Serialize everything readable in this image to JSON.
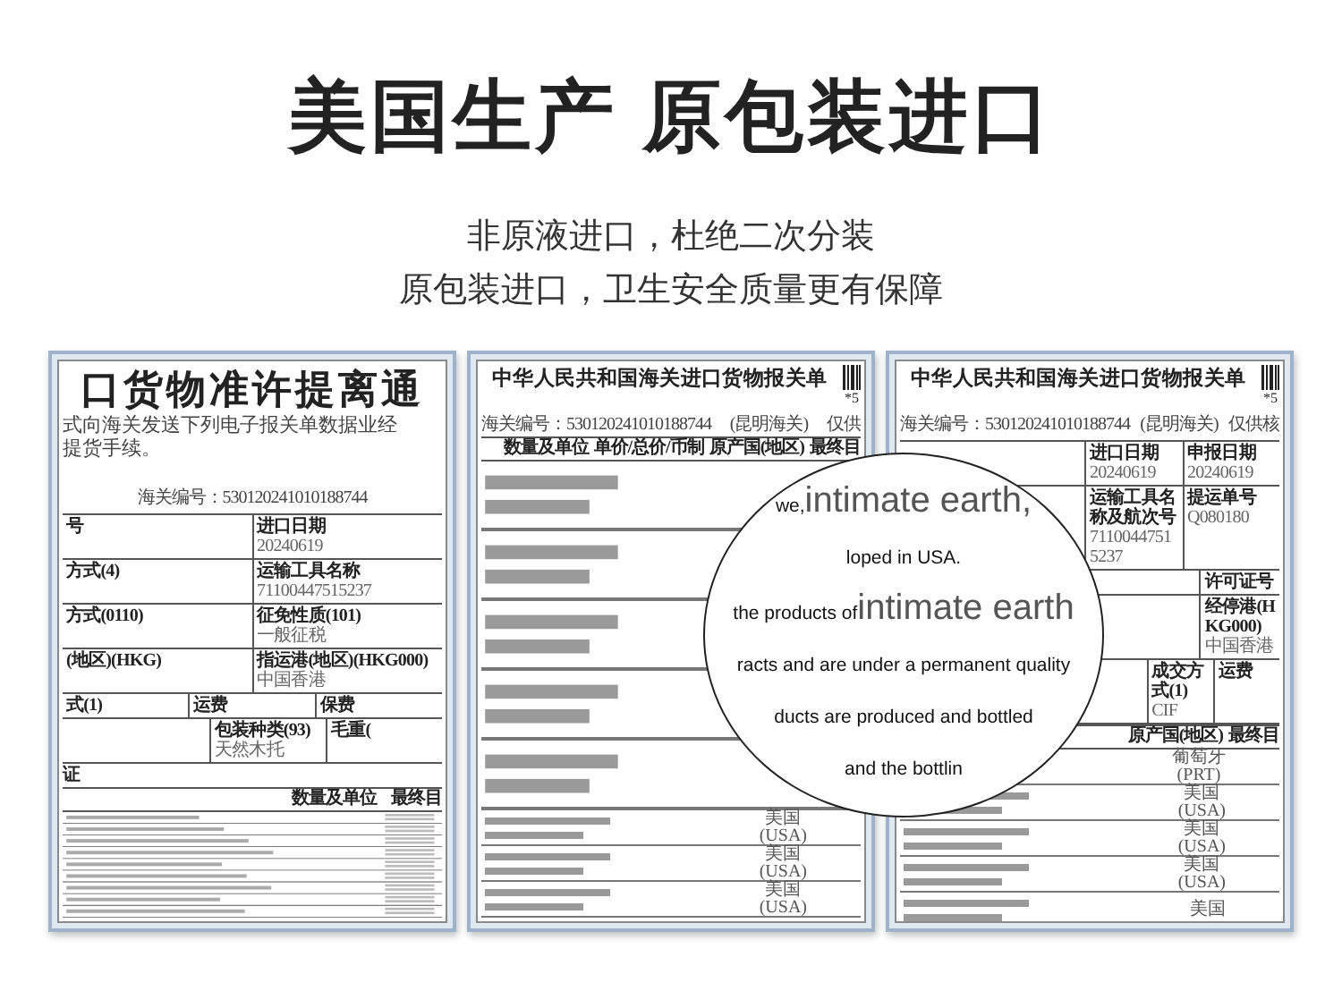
{
  "headline": "美国生产 原包装进口",
  "subtitle_lines": [
    "非原液进口，杜绝二次分装",
    "原包装进口，卫生安全质量更有保障"
  ],
  "documents": [
    {
      "kind": "release_notice",
      "title": "口货物准许提离通",
      "paragraph": [
        "式向海关发送下列电子报关单数据业经",
        "提货手续。"
      ],
      "reference": [
        "海关编号：530120241010188744"
      ],
      "field_rows": [
        [
          {
            "label": "号"
          },
          {
            "label": "进口日期",
            "value": "20240619"
          }
        ],
        [
          {
            "label": "方式(4)"
          },
          {
            "label": "运输工具名称",
            "value": "71100447515237"
          }
        ],
        [
          {
            "label": "方式(0110)"
          },
          {
            "label": "征免性质(101)",
            "value": "一般征税"
          }
        ],
        [
          {
            "label": "(地区)(HKG)"
          },
          {
            "label": "指运港(地区)(HKG000)",
            "value": "中国香港"
          }
        ],
        [
          {
            "label": "式(1)"
          },
          {
            "label": "运费"
          },
          {
            "label": "保费"
          }
        ],
        [
          {},
          {
            "label": "包装种类(93)",
            "value": "天然木托"
          },
          {
            "label": "毛重("
          }
        ]
      ],
      "section_label": "证",
      "table_header": [
        "数量及单位",
        "最终目"
      ]
    },
    {
      "kind": "declaration",
      "title": "中华人民共和国海关进口货物报关单",
      "barcode_mark": "*5",
      "reference": [
        "海关编号：530120241010188744",
        "(昆明海关)",
        "仅供"
      ],
      "table_header": [
        "数量及单位",
        "单价/总价/币制",
        "原产国(地区)",
        "最终目"
      ],
      "items": [
        {
          "origin": "美国",
          "origin_code": "(USA)"
        },
        {
          "origin": "美国",
          "origin_code": "(USA)"
        },
        {
          "origin": "美国",
          "origin_code": "(USA)"
        }
      ]
    },
    {
      "kind": "declaration",
      "title": "中华人民共和国海关进口货物报关单",
      "barcode_mark": "*5",
      "reference": [
        "海关编号：530120241010188744",
        "(昆明海关)",
        "仅供核"
      ],
      "field_rows": [
        [
          {},
          {
            "label": "进口日期",
            "value": "20240619"
          },
          {
            "label": "申报日期",
            "value": "20240619"
          }
        ],
        [
          {},
          {
            "label": "运输工具名称及航次号",
            "value": "71100447515237"
          },
          {
            "label": "提运单号",
            "value": "Q080180"
          }
        ],
        [
          {},
          {},
          {
            "label": "许可证号"
          }
        ],
        [
          {},
          {},
          {
            "label": "经停港(HKG000)",
            "value": "中国香港"
          }
        ],
        [
          {},
          {},
          {
            "label": "成交方式(1)",
            "value": "CIF"
          },
          {
            "label": "运费"
          }
        ]
      ],
      "table_header": [
        "原产国(地区)",
        "最终目"
      ],
      "items": [
        {
          "origin": "葡萄牙",
          "origin_code": "(PRT)"
        },
        {
          "origin": "美国",
          "origin_code": "(USA)"
        },
        {
          "origin": "美国",
          "origin_code": "(USA)"
        },
        {
          "origin": "美国",
          "origin_code": "(USA)"
        },
        {
          "origin": "美国"
        }
      ]
    }
  ],
  "magnifier": {
    "lines": [
      {
        "parts": [
          {
            "text": "we,",
            "large": false
          },
          {
            "text": "intimate earth,",
            "large": true
          }
        ]
      },
      {
        "parts": [
          {
            "text": "loped in USA.",
            "large": false
          }
        ]
      },
      {
        "parts": [
          {
            "text": "the products of",
            "large": false
          },
          {
            "text": "intimate earth",
            "large": true
          }
        ]
      },
      {
        "parts": [
          {
            "text": "racts and are under a permanent quality",
            "large": false
          }
        ]
      },
      {
        "parts": [
          {
            "text": "ducts are produced and bottled",
            "large": false
          }
        ]
      },
      {
        "parts": [
          {
            "text": "and the bottlin",
            "large": false
          }
        ]
      }
    ]
  }
}
